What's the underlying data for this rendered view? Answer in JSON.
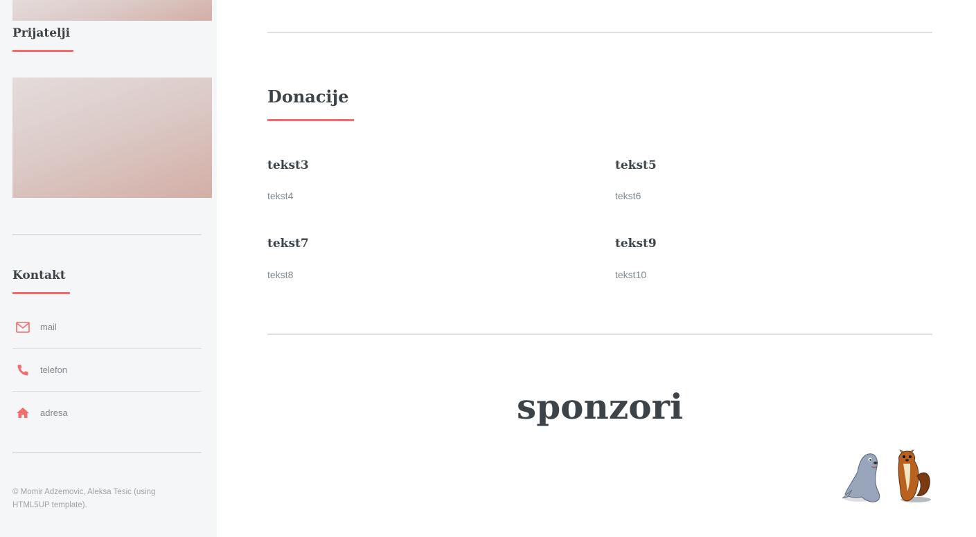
{
  "sidebar": {
    "friends_heading": "Prijatelji",
    "contact_heading": "Kontakt",
    "contacts": [
      {
        "icon": "envelope-icon",
        "label": "mail"
      },
      {
        "icon": "phone-icon",
        "label": "telefon"
      },
      {
        "icon": "home-icon",
        "label": "adresa"
      }
    ],
    "copyright": "© Momir Adzemovic, Aleksa Tesic (using HTML5UP template)."
  },
  "main": {
    "donations": {
      "title": "Donacije",
      "features": [
        {
          "title": "tekst3",
          "text": "tekst4"
        },
        {
          "title": "tekst5",
          "text": "tekst6"
        },
        {
          "title": "tekst7",
          "text": "tekst8"
        },
        {
          "title": "tekst9",
          "text": "tekst10"
        }
      ]
    },
    "sponsors": {
      "title": "sponzori",
      "logo_icon": "sponsor-mascots-logo"
    }
  },
  "colors": {
    "accent": "#f56a6a",
    "heading": "#3d4449",
    "body_text": "#7f888f",
    "sidebar_bg": "#f5f6f7",
    "rule": "#dedfe0"
  }
}
